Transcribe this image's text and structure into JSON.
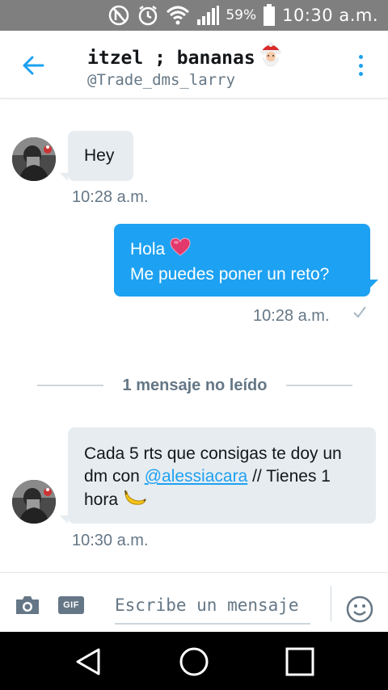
{
  "status_bar": {
    "battery_percent": "59%",
    "time": "10:30 a.m.",
    "icons": [
      "no-disturb-icon",
      "alarm-icon",
      "wifi-icon",
      "signal-icon",
      "battery-icon"
    ]
  },
  "header": {
    "title": "itzel ; bananas",
    "title_emoji": "santa-emoji",
    "handle": "@Trade_dms_larry",
    "accent_color": "#1da1f2"
  },
  "messages": [
    {
      "direction": "incoming",
      "text": "Hey",
      "time": "10:28 a.m."
    },
    {
      "direction": "outgoing",
      "lines": [
        "Hola",
        "Me puedes poner un reto?"
      ],
      "emoji": "heart-emoji",
      "time": "10:28 a.m.",
      "status_icon": "check-icon"
    },
    {
      "direction": "incoming",
      "text_before": "Cada 5 rts que consigas te doy un dm con ",
      "mention": "@alessiacara",
      "text_after": " // Tienes 1 hora",
      "emoji": "banana-emoji",
      "time": "10:30 a.m."
    }
  ],
  "unread_divider": "1 mensaje no leído",
  "composer": {
    "placeholder": "Escribe un mensaje",
    "gif_label": "GIF"
  },
  "colors": {
    "outgoing_bubble": "#1da1f2",
    "incoming_bubble": "#e6ecf0",
    "status_bar": "#7f7f7f",
    "nav_bar": "#000000"
  }
}
